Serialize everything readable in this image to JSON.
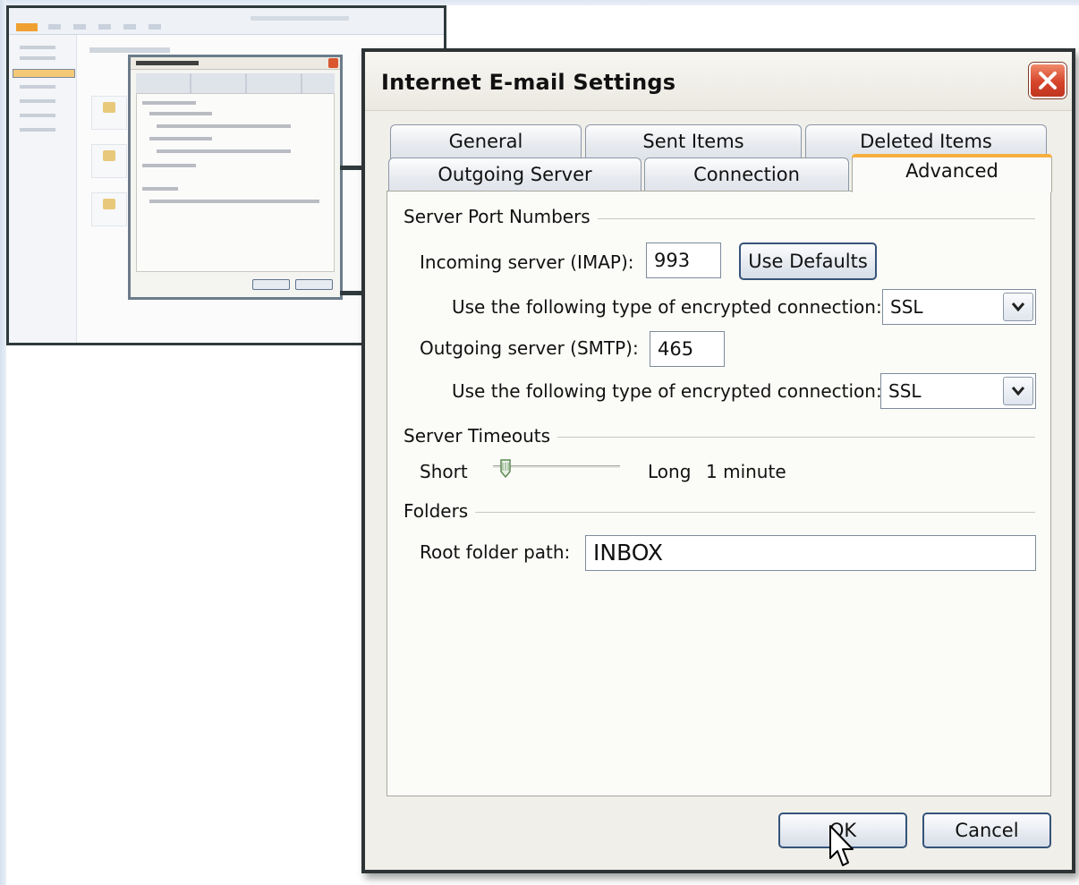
{
  "background_window": {
    "mini_dialog_title": "Internet E-mail Settings"
  },
  "dialog": {
    "title": "Internet E-mail Settings",
    "tabs_row1": [
      "General",
      "Sent Items",
      "Deleted Items"
    ],
    "tabs_row2": [
      "Outgoing Server",
      "Connection",
      "Advanced"
    ],
    "active_tab": "Advanced",
    "server_ports": {
      "group_label": "Server Port Numbers",
      "incoming_label": "Incoming server (IMAP):",
      "incoming_value": "993",
      "use_defaults_label": "Use Defaults",
      "incoming_encryption_label": "Use the following type of encrypted connection:",
      "incoming_encryption_value": "SSL",
      "outgoing_label": "Outgoing server (SMTP):",
      "outgoing_value": "465",
      "outgoing_encryption_label": "Use the following type of encrypted connection:",
      "outgoing_encryption_value": "SSL"
    },
    "timeouts": {
      "group_label": "Server Timeouts",
      "short_label": "Short",
      "long_label": "Long",
      "value_label": "1 minute",
      "slider_fraction": 0.1
    },
    "folders": {
      "group_label": "Folders",
      "root_label": "Root folder path:",
      "root_value": "INBOX"
    },
    "ok_label": "OK",
    "cancel_label": "Cancel"
  },
  "colors": {
    "active_tab_accent": "#f5b041",
    "close_button": "#d6442b",
    "button_border": "#36537a"
  }
}
